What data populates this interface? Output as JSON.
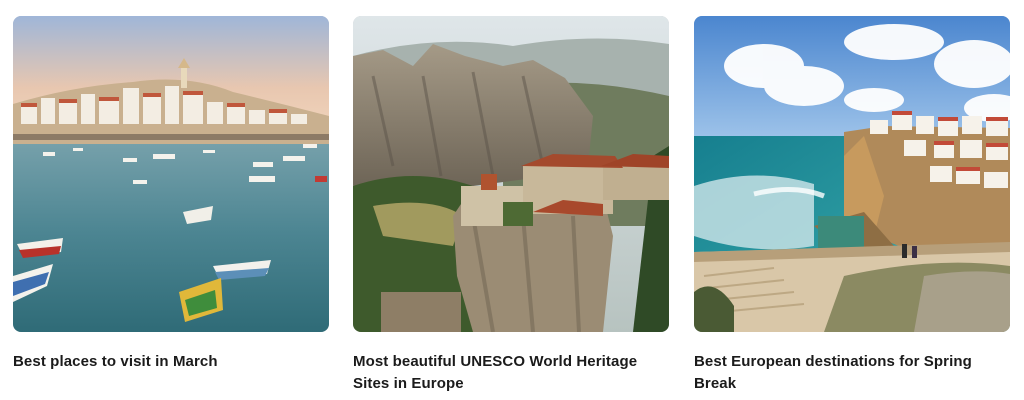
{
  "cards": [
    {
      "title": "Best places to visit in March",
      "image": "harbor-village-boats-image"
    },
    {
      "title": "Most beautiful UNESCO World Heritage Sites in Europe",
      "image": "cliff-monastery-image"
    },
    {
      "title": "Best European destinations for Spring Break",
      "image": "coastal-cliff-town-image"
    }
  ]
}
